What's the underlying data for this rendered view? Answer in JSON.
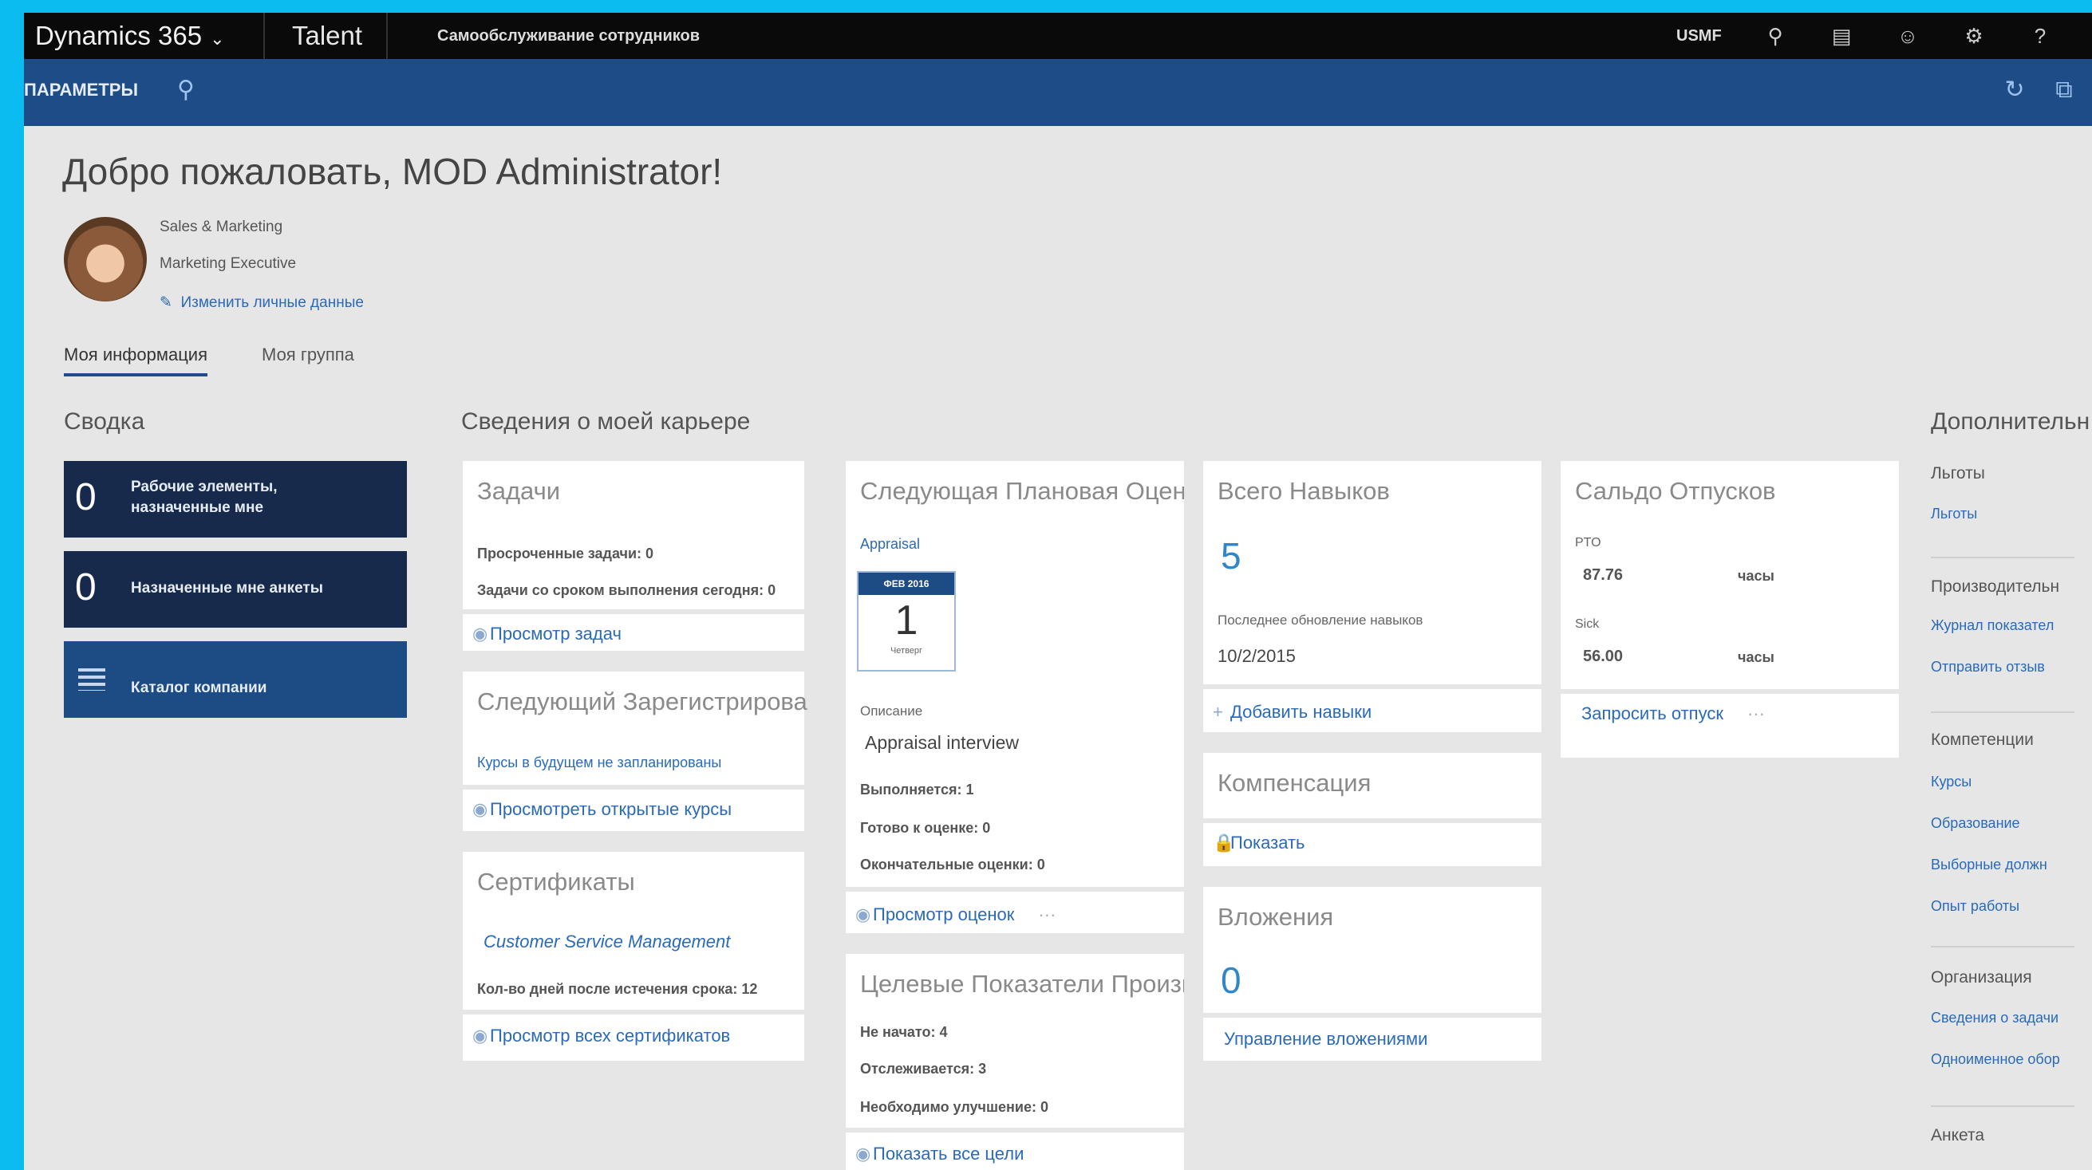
{
  "topbar": {
    "app_name": "Dynamics 365",
    "module": "Talent",
    "subtitle": "Самообслуживание сотрудников",
    "company": "USMF"
  },
  "actionbar": {
    "label": "ПАРАМЕТРЫ"
  },
  "welcome": "Добро пожаловать, MOD Administrator!",
  "profile": {
    "department": "Sales & Marketing",
    "position": "Marketing Executive",
    "edit_link": "Изменить личные данные"
  },
  "tabs": [
    "Моя информация",
    "Моя группа"
  ],
  "summary": {
    "title": "Сводка",
    "tiles": [
      {
        "count": "0",
        "label": "Рабочие элементы, назначенные мне"
      },
      {
        "count": "0",
        "label": "Назначенные мне анкеты"
      },
      {
        "count": "",
        "label": "Каталог компании"
      }
    ]
  },
  "career": {
    "title": "Сведения о моей карьере",
    "tasks": {
      "title": "Задачи",
      "overdue": "Просроченные задачи: 0",
      "due_today": "Задачи со сроком выполнения сегодня: 0",
      "footer": "Просмотр задач"
    },
    "next_course": {
      "title": "Следующий Зарегистрирова",
      "note": "Курсы в будущем не запланированы",
      "footer": "Просмотреть открытые курсы"
    },
    "certificates": {
      "title": "Сертификаты",
      "item": "Customer Service Management",
      "days": "Кол-во дней после истечения срока: 12",
      "footer": "Просмотр всех сертификатов"
    },
    "next_review": {
      "title": "Следующая Плановая Оценка",
      "type": "Appraisal",
      "cal_month": "ФЕВ 2016",
      "cal_day": "1",
      "cal_weekday": "Четверг",
      "desc_label": "Описание",
      "desc": "Appraisal interview",
      "done": "Выполняется: 1",
      "ready": "Готово к оценке: 0",
      "final": "Окончательные оценки: 0",
      "footer": "Просмотр оценок"
    },
    "goals": {
      "title": "Целевые Показатели Произв",
      "not_started": "Не начато: 4",
      "tracked": "Отслеживается: 3",
      "needs_improvement": "Необходимо улучшение: 0",
      "footer": "Показать все цели"
    },
    "skills": {
      "title": "Всего Навыков",
      "count": "5",
      "updated_label": "Последнее обновление навыков",
      "updated": "10/2/2015",
      "footer": "Добавить навыки"
    },
    "compensation": {
      "title": "Компенсация",
      "footer": "Показать"
    },
    "attachments": {
      "title": "Вложения",
      "count": "0",
      "footer": "Управление вложениями"
    },
    "leave": {
      "title": "Сальдо Отпусков",
      "pto_label": "PTO",
      "pto_value": "87.76",
      "pto_unit": "часы",
      "sick_label": "Sick",
      "sick_value": "56.00",
      "sick_unit": "часы",
      "footer": "Запросить отпуск"
    }
  },
  "right": {
    "title": "Дополнительн",
    "groups": [
      {
        "head": "Льготы",
        "links": [
          "Льготы"
        ]
      },
      {
        "head": "Производительн",
        "links": [
          "Журнал показател",
          "Отправить отзыв"
        ]
      },
      {
        "head": "Компетенции",
        "links": [
          "Курсы",
          "Образование",
          "Выборные должн",
          "Опыт работы"
        ]
      },
      {
        "head": "Организация",
        "links": [
          "Сведения о задачи",
          "Одноименное обор"
        ]
      },
      {
        "head": "Анкета",
        "links": []
      }
    ]
  }
}
